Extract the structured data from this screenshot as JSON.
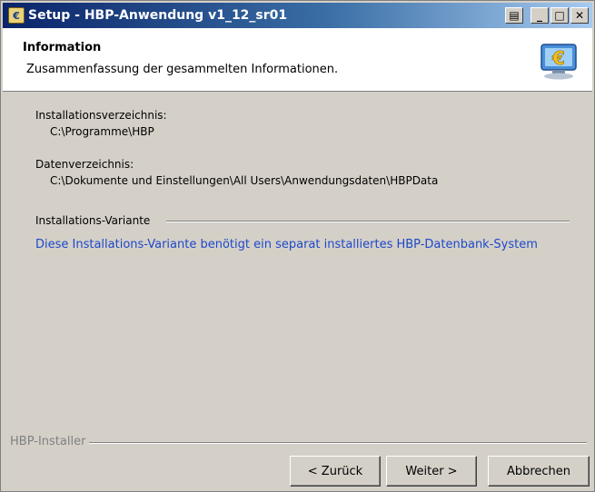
{
  "window": {
    "title": "Setup - HBP-Anwendung v1_12_sr01",
    "controls": [
      "print",
      "minimize",
      "maximize",
      "close"
    ]
  },
  "header": {
    "title": "Information",
    "subtitle": "Zusammenfassung der gesammelten Informationen.",
    "icon": "euro-computer-icon"
  },
  "summary": {
    "install_dir_label": "Installationsverzeichnis:",
    "install_dir_value": "C:\\Programme\\HBP",
    "data_dir_label": "Datenverzeichnis:",
    "data_dir_value": "C:\\Dokumente und Einstellungen\\All Users\\Anwendungsdaten\\HBPData",
    "variant_group_label": "Installations-Variante",
    "variant_notice": "Diese Installations-Variante benötigt ein separat installiertes HBP-Datenbank-System"
  },
  "footer": {
    "installer_label": "HBP-Installer",
    "back_label": "< Zurück",
    "next_label": "Weiter >",
    "cancel_label": "Abbrechen"
  },
  "colors": {
    "titlebar_start": "#0a246a",
    "notice_text": "#1e48c8",
    "dialog_bg": "#d4d0c8"
  }
}
